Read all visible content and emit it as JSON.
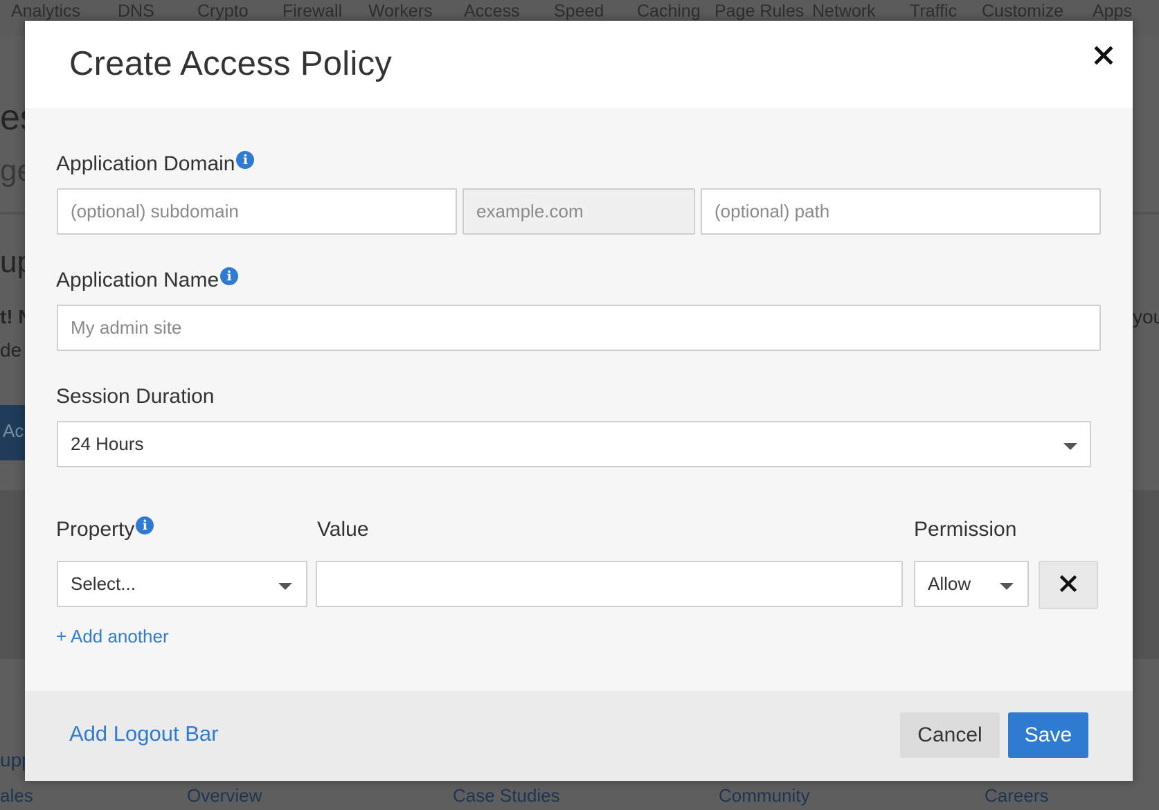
{
  "background": {
    "nav": [
      "Analytics",
      "DNS",
      "Crypto",
      "Firewall",
      "Workers",
      "Access",
      "Speed",
      "Caching",
      "Page Rules",
      "Network",
      "Traffic",
      "Customize",
      "Apps"
    ],
    "fragments": [
      "es",
      "ge",
      "up",
      "t! N",
      "de",
      "you",
      "Ac",
      "upp"
    ],
    "footer": [
      "ales",
      "Overview",
      "Case Studies",
      "Community",
      "Careers"
    ]
  },
  "modal": {
    "title": "Create Access Policy",
    "domain": {
      "label": "Application Domain",
      "subdomain_placeholder": "(optional) subdomain",
      "domain_placeholder": "example.com",
      "path_placeholder": "(optional) path"
    },
    "name": {
      "label": "Application Name",
      "placeholder": "My admin site"
    },
    "session": {
      "label": "Session Duration",
      "value": "24 Hours"
    },
    "rules": {
      "property_label": "Property",
      "value_label": "Value",
      "permission_label": "Permission",
      "property_value": "Select...",
      "permission_value": "Allow",
      "add_another": "+ Add another"
    },
    "footer": {
      "logout_bar": "Add Logout Bar",
      "cancel": "Cancel",
      "save": "Save"
    }
  },
  "colors": {
    "accent": "#2f7bd1",
    "overlay": "#5e5e5e"
  },
  "icons": {
    "close": "close-icon",
    "info": "info-icon",
    "dropdown": "chevron-down-icon",
    "remove": "remove-icon"
  }
}
